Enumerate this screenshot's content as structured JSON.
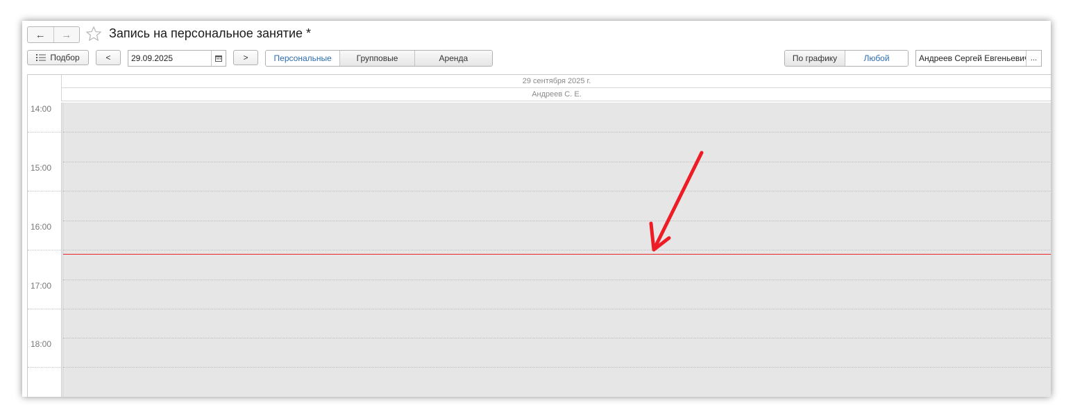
{
  "window": {
    "title": "Запись на персональное занятие *"
  },
  "toolbar": {
    "back_icon": "←",
    "forward_icon": "→",
    "pick_label": "Подбор",
    "prev_label": "<",
    "date_value": "29.09.2025",
    "next_label": ">",
    "tabs": [
      {
        "label": "Персональные",
        "active": true
      },
      {
        "label": "Групповые",
        "active": false
      },
      {
        "label": "Аренда",
        "active": false
      }
    ],
    "schedule_label": "По графику",
    "any_label": "Любой",
    "employee_value": "Андреев Сергей Евгеньевич",
    "more_label": "..."
  },
  "calendar": {
    "date_header": "29 сентября 2025 г.",
    "resource_header": "Андреев С. Е.",
    "times": [
      "14:00",
      "15:00",
      "16:00",
      "17:00",
      "18:00"
    ]
  },
  "colors": {
    "accent": "#2b6cb0",
    "now_line": "#e8262a",
    "busy_bg": "#e6e6e6",
    "annotation_arrow": "#ee1c25"
  }
}
